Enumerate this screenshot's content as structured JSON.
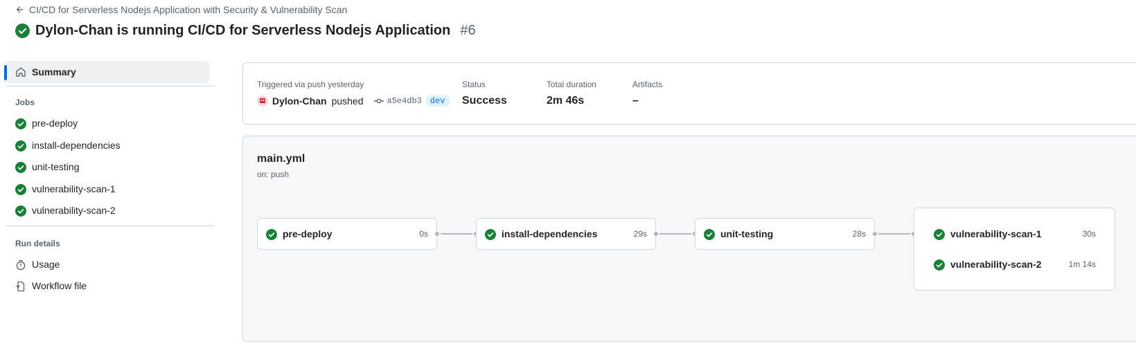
{
  "header": {
    "back_label": "CI/CD for Serverless Nodejs Application with Security & Vulnerability Scan",
    "title": "Dylon-Chan is running CI/CD for Serverless Nodejs Application",
    "run_number": "#6"
  },
  "sidebar": {
    "summary_label": "Summary",
    "jobs_heading": "Jobs",
    "jobs": [
      {
        "label": "pre-deploy"
      },
      {
        "label": "install-dependencies"
      },
      {
        "label": "unit-testing"
      },
      {
        "label": "vulnerability-scan-1"
      },
      {
        "label": "vulnerability-scan-2"
      }
    ],
    "run_details_heading": "Run details",
    "usage_label": "Usage",
    "workflow_file_label": "Workflow file"
  },
  "summary": {
    "trigger_label": "Triggered via push yesterday",
    "actor": "Dylon-Chan",
    "action": "pushed",
    "commit_sha": "a5e4db3",
    "branch": "dev",
    "status_label": "Status",
    "status_value": "Success",
    "duration_label": "Total duration",
    "duration_value": "2m 46s",
    "artifacts_label": "Artifacts",
    "artifacts_value": "–"
  },
  "workflow": {
    "file_name": "main.yml",
    "trigger": "on: push",
    "jobs": [
      {
        "name": "pre-deploy",
        "duration": "0s"
      },
      {
        "name": "install-dependencies",
        "duration": "29s"
      },
      {
        "name": "unit-testing",
        "duration": "28s"
      }
    ],
    "parallel_jobs": [
      {
        "name": "vulnerability-scan-1",
        "duration": "30s"
      },
      {
        "name": "vulnerability-scan-2",
        "duration": "1m 14s"
      }
    ]
  },
  "colors": {
    "success": "#1a7f37",
    "accent": "#0969da",
    "border": "#d1d9e0",
    "muted_text": "#59636e"
  },
  "icons": [
    "arrow-left-icon",
    "check-circle-fill-icon",
    "home-icon",
    "stopwatch-icon",
    "workflow-file-icon",
    "git-commit-icon"
  ]
}
